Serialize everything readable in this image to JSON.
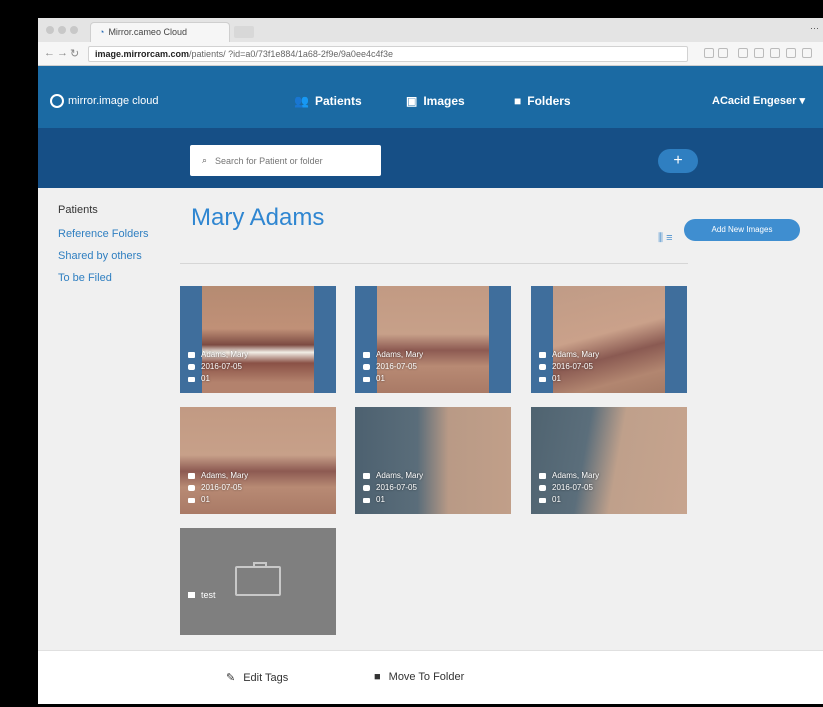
{
  "browser": {
    "tab_title": "Mirror.cameo Cloud",
    "url_host": "image.mirrorcam.com",
    "url_path": "/patients/ ?id=a0/73f1e884/1a68-2f9e/9a0ee4c4f3e",
    "controls": "⋯"
  },
  "nav": {
    "logo": "mirror.image cloud",
    "items": [
      {
        "label": "Patients",
        "icon": "users-icon"
      },
      {
        "label": "Images",
        "icon": "images-icon"
      },
      {
        "label": "Folders",
        "icon": "folder-icon"
      }
    ],
    "user": "ACacid Engeser ▾"
  },
  "search": {
    "placeholder": "Search for Patient or folder",
    "add_label": "+"
  },
  "sidebar": {
    "header": "Patients",
    "links": [
      {
        "label": "Reference Folders"
      },
      {
        "label": "Shared by others"
      },
      {
        "label": "To be Filed"
      }
    ]
  },
  "page": {
    "title": "Mary Adams",
    "upload_label": "Add New Images",
    "view_toggle": "⫼ ≡"
  },
  "images": [
    {
      "name": "Adams, Mary",
      "date": "2016-07-05",
      "tag": "01"
    },
    {
      "name": "Adams, Mary",
      "date": "2016-07-05",
      "tag": "01"
    },
    {
      "name": "Adams, Mary",
      "date": "2016-07-05",
      "tag": "01"
    },
    {
      "name": "Adams, Mary",
      "date": "2016-07-05",
      "tag": "01"
    },
    {
      "name": "Adams, Mary",
      "date": "2016-07-05",
      "tag": "01"
    },
    {
      "name": "Adams, Mary",
      "date": "2016-07-05",
      "tag": "01"
    }
  ],
  "folder_tile": {
    "label": "test"
  },
  "footer": {
    "edit_tags": "Edit Tags",
    "move_to_folder": "Move To Folder"
  }
}
